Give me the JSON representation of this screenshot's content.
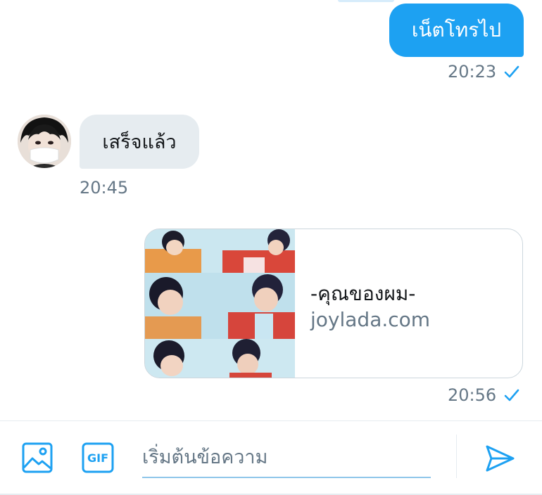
{
  "messages": [
    {
      "direction": "outgoing",
      "text": "เน็ตโทรไป",
      "time": "20:23",
      "read": true
    },
    {
      "direction": "incoming",
      "text": "เสร็จแล้ว",
      "time": "20:45"
    },
    {
      "direction": "outgoing",
      "type": "link_card",
      "title": "-คุณของผม-",
      "domain": "joylada.com",
      "time": "20:56",
      "read": true
    }
  ],
  "composer": {
    "placeholder": "เริ่มต้นข้อความ",
    "gif_label": "GIF",
    "icons": [
      "image-icon",
      "gif-icon",
      "send-icon"
    ]
  },
  "colors": {
    "accent": "#1da1f2",
    "incoming_bubble": "#e6ecf0",
    "secondary_text": "#657786"
  }
}
